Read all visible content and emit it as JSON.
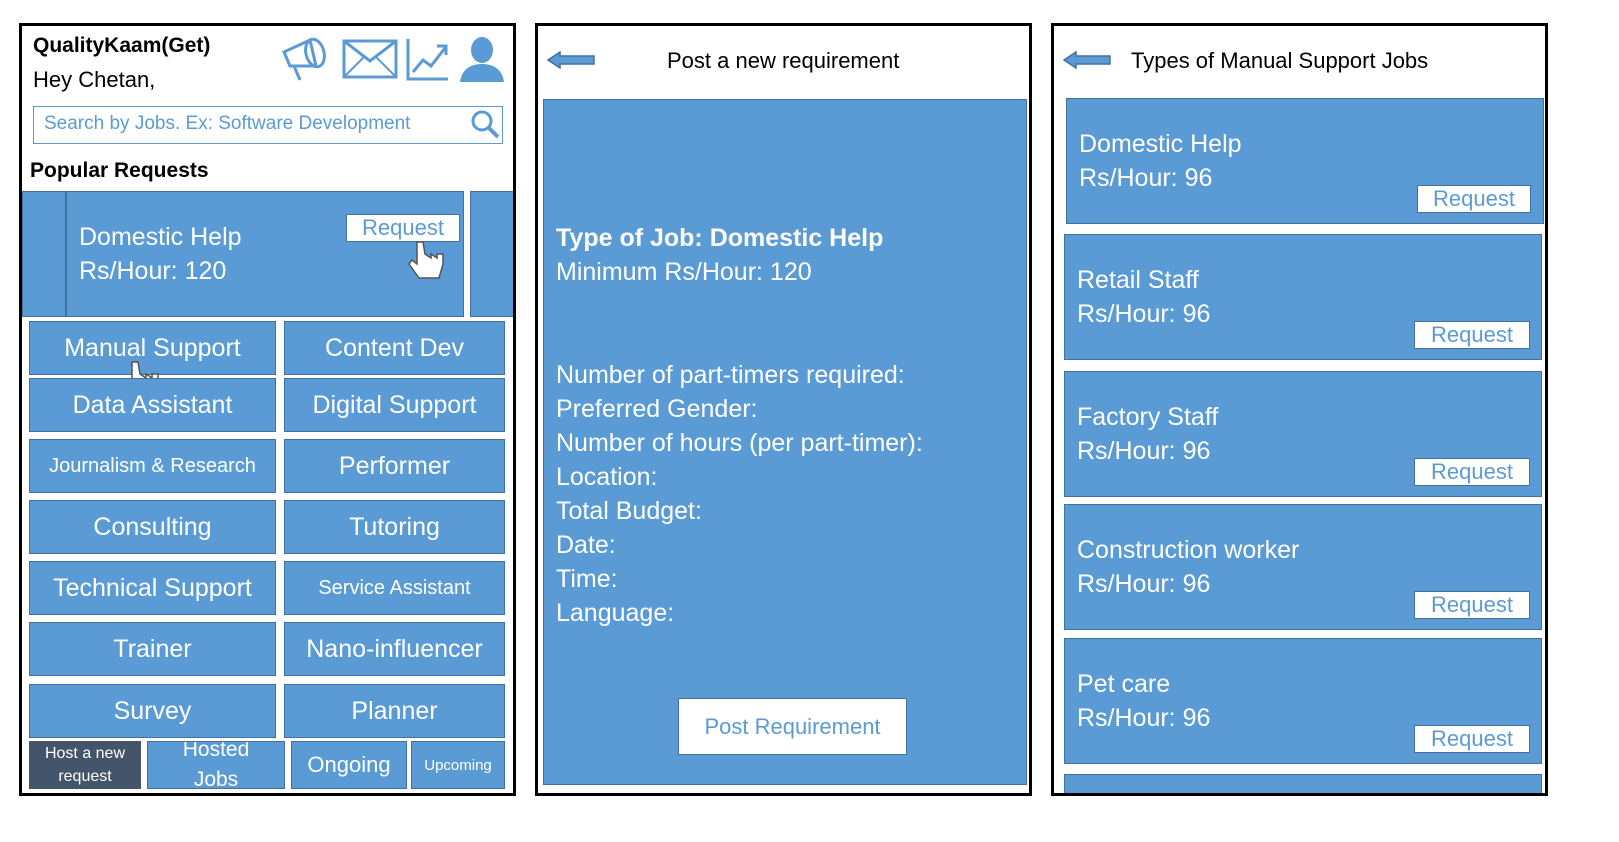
{
  "home": {
    "app_name": "QualityKaam(Get)",
    "greeting": "Hey Chetan,",
    "search_placeholder": "Search by Jobs. Ex: Software Development",
    "popular_heading": "Popular Requests",
    "popular_card": {
      "title": "Domestic Help",
      "rate": "Rs/Hour: 120",
      "button": "Request"
    },
    "categories": [
      "Manual Support",
      "Content Dev",
      "Data Assistant",
      "Digital Support",
      "Journalism & Research",
      "Performer",
      "Consulting",
      "Tutoring",
      "Technical Support",
      "Service Assistant",
      "Trainer",
      "Nano-influencer",
      "Survey",
      "Planner"
    ],
    "bottom_nav": [
      "Host a new request",
      "Hosted Jobs",
      "Ongoing",
      "Upcoming"
    ]
  },
  "post": {
    "title": "Post a new requirement",
    "job_type": "Type of Job: Domestic Help",
    "min_rate": "Minimum Rs/Hour: 120",
    "fields": [
      "Number of part-timers required:",
      "Preferred Gender:",
      "Number of hours (per part-timer):",
      "Location:",
      "Total Budget:",
      "Date:",
      "Time:",
      "Language:"
    ],
    "submit": "Post Requirement"
  },
  "types": {
    "title": "Types of Manual Support Jobs",
    "jobs": [
      {
        "name": "Domestic Help",
        "rate": "Rs/Hour: 96",
        "button": "Request"
      },
      {
        "name": "Retail Staff",
        "rate": "Rs/Hour: 96",
        "button": "Request"
      },
      {
        "name": "Factory Staff",
        "rate": "Rs/Hour: 96",
        "button": "Request"
      },
      {
        "name": "Construction worker",
        "rate": "Rs/Hour: 96",
        "button": "Request"
      },
      {
        "name": "Pet care",
        "rate": "Rs/Hour: 96",
        "button": "Request"
      }
    ]
  },
  "colors": {
    "tile": "#5b9bd5",
    "tile_border": "#41719c",
    "nav_active": "#44546a"
  },
  "icons": [
    "megaphone-icon",
    "mail-icon",
    "trend-chart-icon",
    "user-icon",
    "search-icon",
    "back-arrow-icon",
    "hand-pointer-icon"
  ]
}
